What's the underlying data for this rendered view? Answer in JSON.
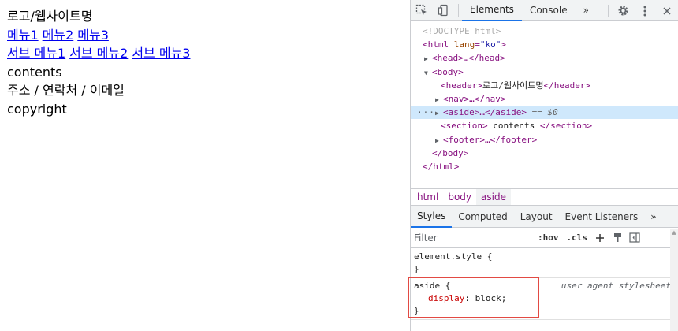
{
  "page": {
    "header": "로고/웹사이트명",
    "nav": [
      "메뉴1",
      "메뉴2",
      "메뉴3"
    ],
    "aside": [
      "서브 메뉴1",
      "서브 메뉴2",
      "서브 메뉴3"
    ],
    "section": "contents",
    "address": "주소 / 연락처 / 이메일",
    "footer": "copyright"
  },
  "devtools": {
    "tabs": {
      "elements": "Elements",
      "console": "Console",
      "more": "»"
    },
    "dom": {
      "doctype": "<!DOCTYPE html>",
      "html_open_tag": "<html",
      "html_attr": "lang",
      "html_attr_value": "\"ko\"",
      "head": "<head>…</head>",
      "body_open": "<body>",
      "header_open": "<header>",
      "header_text": "로고/웹사이트명",
      "header_close": "</header>",
      "nav": "<nav>…</nav>",
      "aside": "<aside>…</aside>",
      "selected_marker": "== $0",
      "section_open": "<section>",
      "section_text": " contents ",
      "section_close": "</section>",
      "footer": "<footer>…</footer>",
      "body_close": "</body>",
      "html_close": "</html>"
    },
    "breadcrumbs": [
      "html",
      "body",
      "aside"
    ],
    "subtabs": [
      "Styles",
      "Computed",
      "Layout",
      "Event Listeners",
      "»"
    ],
    "filter_placeholder": "Filter",
    "filter_hov": ":hov",
    "filter_cls": ".cls",
    "styles": {
      "element_style_selector": "element.style {",
      "element_style_close": "}",
      "aside_selector": "aside {",
      "aside_source": "user agent stylesheet",
      "aside_prop": "display",
      "aside_value": "block;",
      "aside_close": "}"
    },
    "colors": {
      "accent": "#1a73e8",
      "highlight": "#e24a43",
      "selected_row": "#cfe8fc"
    }
  }
}
